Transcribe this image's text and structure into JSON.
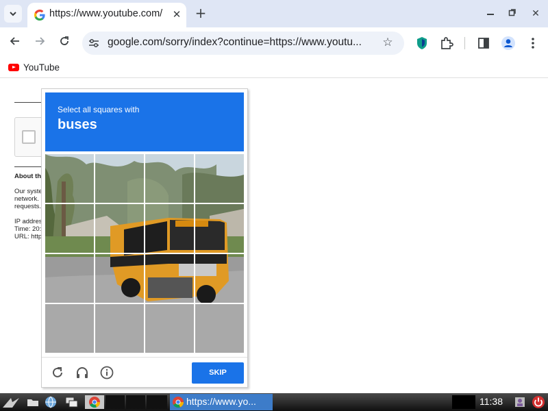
{
  "tab": {
    "title": "https://www.youtube.com/"
  },
  "omnibox": {
    "url": "google.com/sorry/index?continue=https://www.youtu..."
  },
  "bookmarks": {
    "youtube_label": "YouTube"
  },
  "background_page": {
    "about_heading": "About th",
    "lines": [
      "Our syste",
      "network.",
      "requests.",
      "IP addres",
      "Time: 20:",
      "URL: http"
    ]
  },
  "captcha": {
    "instruction": "Select all squares with",
    "object": "buses",
    "grid_rows": 4,
    "grid_cols": 4,
    "skip_label": "SKIP"
  },
  "taskbar": {
    "active_window_label": "https://www.yo...",
    "clock": "11:38"
  },
  "colors": {
    "accent": "#1a73e8",
    "tabstrip": "#dfe6f5",
    "omnibox": "#eef2f9",
    "youtube_red": "#ff0000",
    "taskbar_active": "#3d7cc9"
  },
  "icons": [
    "tab-search-icon",
    "google-icon",
    "close-icon",
    "plus-icon",
    "minimize-icon",
    "restore-icon",
    "back-icon",
    "forward-icon",
    "reload-icon",
    "site-info-icon",
    "star-icon",
    "shield-icon",
    "extensions-icon",
    "side-panel-icon",
    "profile-icon",
    "menu-icon",
    "youtube-icon",
    "refresh-icon",
    "headphones-icon",
    "info-icon",
    "power-icon"
  ]
}
